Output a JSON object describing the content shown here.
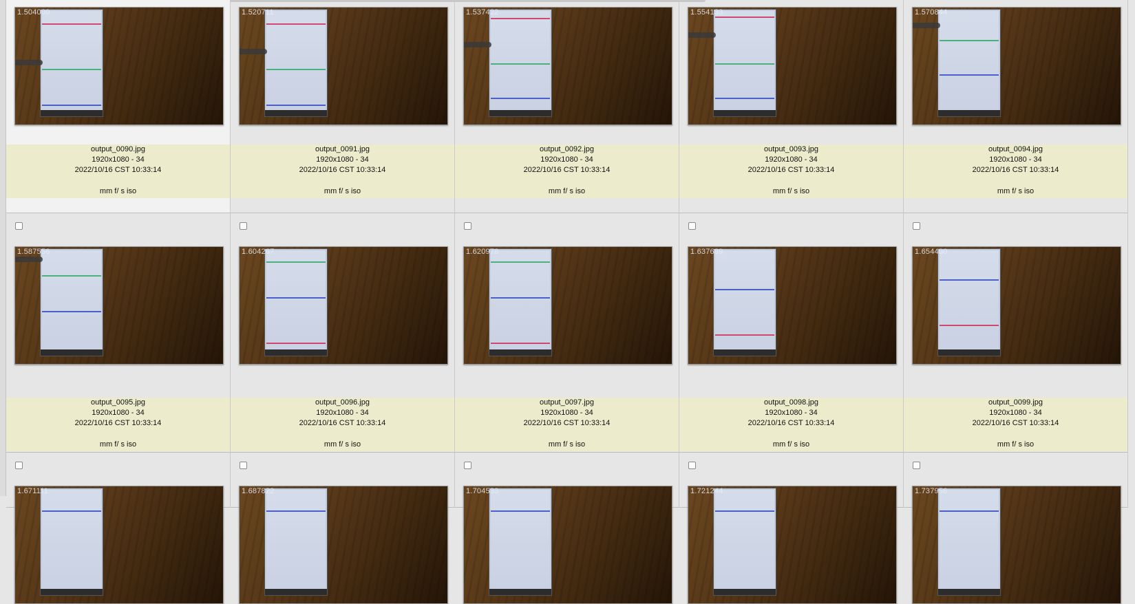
{
  "browser": {
    "rows": [
      {
        "items": [
          {
            "filename": "output_0090.jpg",
            "dims": "1920x1080 - 34",
            "date": "2022/10/16 CST 10:33:14",
            "exif": "mm f/ s iso",
            "timestamp": "1.504000",
            "selected": true
          },
          {
            "filename": "output_0091.jpg",
            "dims": "1920x1080 - 34",
            "date": "2022/10/16 CST 10:33:14",
            "exif": "mm f/ s iso",
            "timestamp": "1.520711"
          },
          {
            "filename": "output_0092.jpg",
            "dims": "1920x1080 - 34",
            "date": "2022/10/16 CST 10:33:14",
            "exif": "mm f/ s iso",
            "timestamp": "1.537422"
          },
          {
            "filename": "output_0093.jpg",
            "dims": "1920x1080 - 34",
            "date": "2022/10/16 CST 10:33:14",
            "exif": "mm f/ s iso",
            "timestamp": "1.554133"
          },
          {
            "filename": "output_0094.jpg",
            "dims": "1920x1080 - 34",
            "date": "2022/10/16 CST 10:33:14",
            "exif": "mm f/ s iso",
            "timestamp": "1.570844"
          }
        ]
      },
      {
        "items": [
          {
            "filename": "output_0095.jpg",
            "dims": "1920x1080 - 34",
            "date": "2022/10/16 CST 10:33:14",
            "exif": "mm f/ s iso",
            "timestamp": "1.587556"
          },
          {
            "filename": "output_0096.jpg",
            "dims": "1920x1080 - 34",
            "date": "2022/10/16 CST 10:33:14",
            "exif": "mm f/ s iso",
            "timestamp": "1.604267"
          },
          {
            "filename": "output_0097.jpg",
            "dims": "1920x1080 - 34",
            "date": "2022/10/16 CST 10:33:14",
            "exif": "mm f/ s iso",
            "timestamp": "1.620978"
          },
          {
            "filename": "output_0098.jpg",
            "dims": "1920x1080 - 34",
            "date": "2022/10/16 CST 10:33:14",
            "exif": "mm f/ s iso",
            "timestamp": "1.637689"
          },
          {
            "filename": "output_0099.jpg",
            "dims": "1920x1080 - 34",
            "date": "2022/10/16 CST 10:33:14",
            "exif": "mm f/ s iso",
            "timestamp": "1.654400"
          }
        ]
      },
      {
        "items": [
          {
            "timestamp": "1.671111"
          },
          {
            "timestamp": "1.687822"
          },
          {
            "timestamp": "1.704533"
          },
          {
            "timestamp": "1.721244"
          },
          {
            "timestamp": "1.737956"
          }
        ]
      }
    ],
    "colors": {
      "info_strip": "#ececcd",
      "background": "#e6e6e6",
      "selected_cell": "#f2f2f2"
    }
  }
}
